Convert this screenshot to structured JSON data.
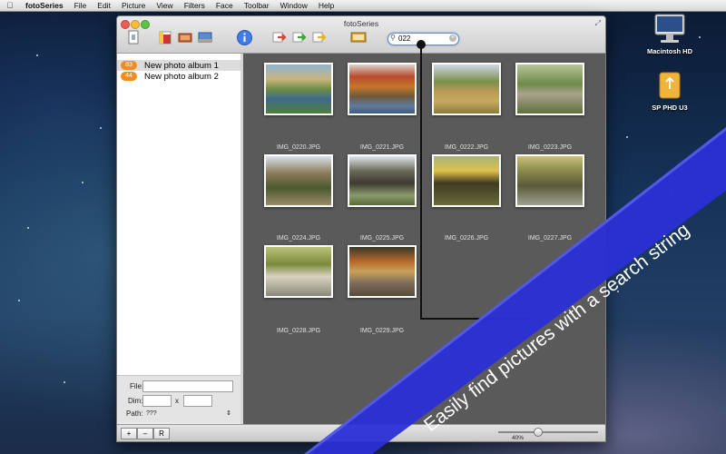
{
  "menubar": {
    "app_name": "fotoSeries",
    "items": [
      "File",
      "Edit",
      "Picture",
      "View",
      "Filters",
      "Face",
      "Toolbar",
      "Window",
      "Help"
    ]
  },
  "window": {
    "title": "fotoSeries"
  },
  "search": {
    "value": "022"
  },
  "albums": [
    {
      "count": "83",
      "name": "New photo album 1",
      "selected": true
    },
    {
      "count": "44",
      "name": "New photo album 2",
      "selected": false
    }
  ],
  "photos": [
    {
      "name": "IMG_0220.JPG"
    },
    {
      "name": "IMG_0221.JPG"
    },
    {
      "name": "IMG_0222.JPG"
    },
    {
      "name": "IMG_0223.JPG"
    },
    {
      "name": "IMG_0224.JPG"
    },
    {
      "name": "IMG_0225.JPG"
    },
    {
      "name": "IMG_0226.JPG"
    },
    {
      "name": "IMG_0227.JPG"
    },
    {
      "name": "IMG_0228.JPG"
    },
    {
      "name": "IMG_0229.JPG"
    }
  ],
  "info_panel": {
    "file_label": "File:",
    "dim_label": "Dim:",
    "dim_separator": "x",
    "path_label": "Path:",
    "path_value": "???"
  },
  "bottombar": {
    "add_label": "+",
    "remove_label": "–",
    "r_label": "R",
    "zoom_label": "40%",
    "zoom_fraction": 0.4
  },
  "desktop": {
    "disk1": "Macintosh HD",
    "disk2": "SP PHD U3"
  },
  "promo": {
    "text": "Easily find pictures with a search string",
    "color": "#2b2fd6"
  }
}
